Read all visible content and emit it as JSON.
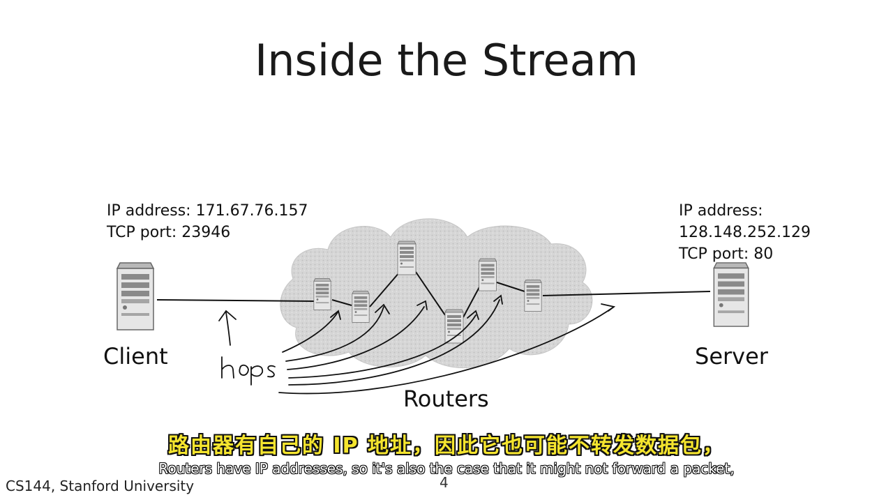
{
  "slide": {
    "title": "Inside the Stream",
    "footer": "CS144, Stanford University",
    "page_number": "4"
  },
  "client": {
    "ip_line": "IP address: 171.67.76.157",
    "port_line": "TCP port: 23946",
    "label": "Client"
  },
  "server": {
    "ip_line": "IP address: 128.148.252.129",
    "port_line": "TCP port: 80",
    "label": "Server"
  },
  "network": {
    "routers_label": "Routers",
    "handwritten_note": "hops"
  },
  "subtitles": {
    "chinese": "路由器有自己的 IP 地址，因此它也可能不转发数据包，",
    "english": "Routers have IP addresses, so it's also the case that it might not forward a packet,"
  }
}
